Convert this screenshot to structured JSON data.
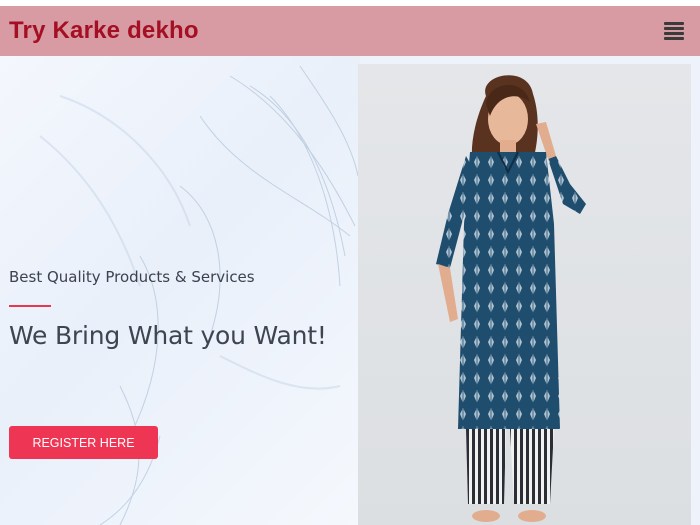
{
  "header": {
    "brand": "Try Karke dekho",
    "menu_icon": "hamburger-menu-icon"
  },
  "hero": {
    "tagline": "Best Quality Products & Services",
    "headline": "We Bring What you Want!",
    "cta_label": "REGISTER HERE"
  },
  "colors": {
    "header_bg": "#d99ba3",
    "brand_text": "#a40f24",
    "accent": "#ee3654",
    "kurta_blue": "#1f4d6e"
  }
}
